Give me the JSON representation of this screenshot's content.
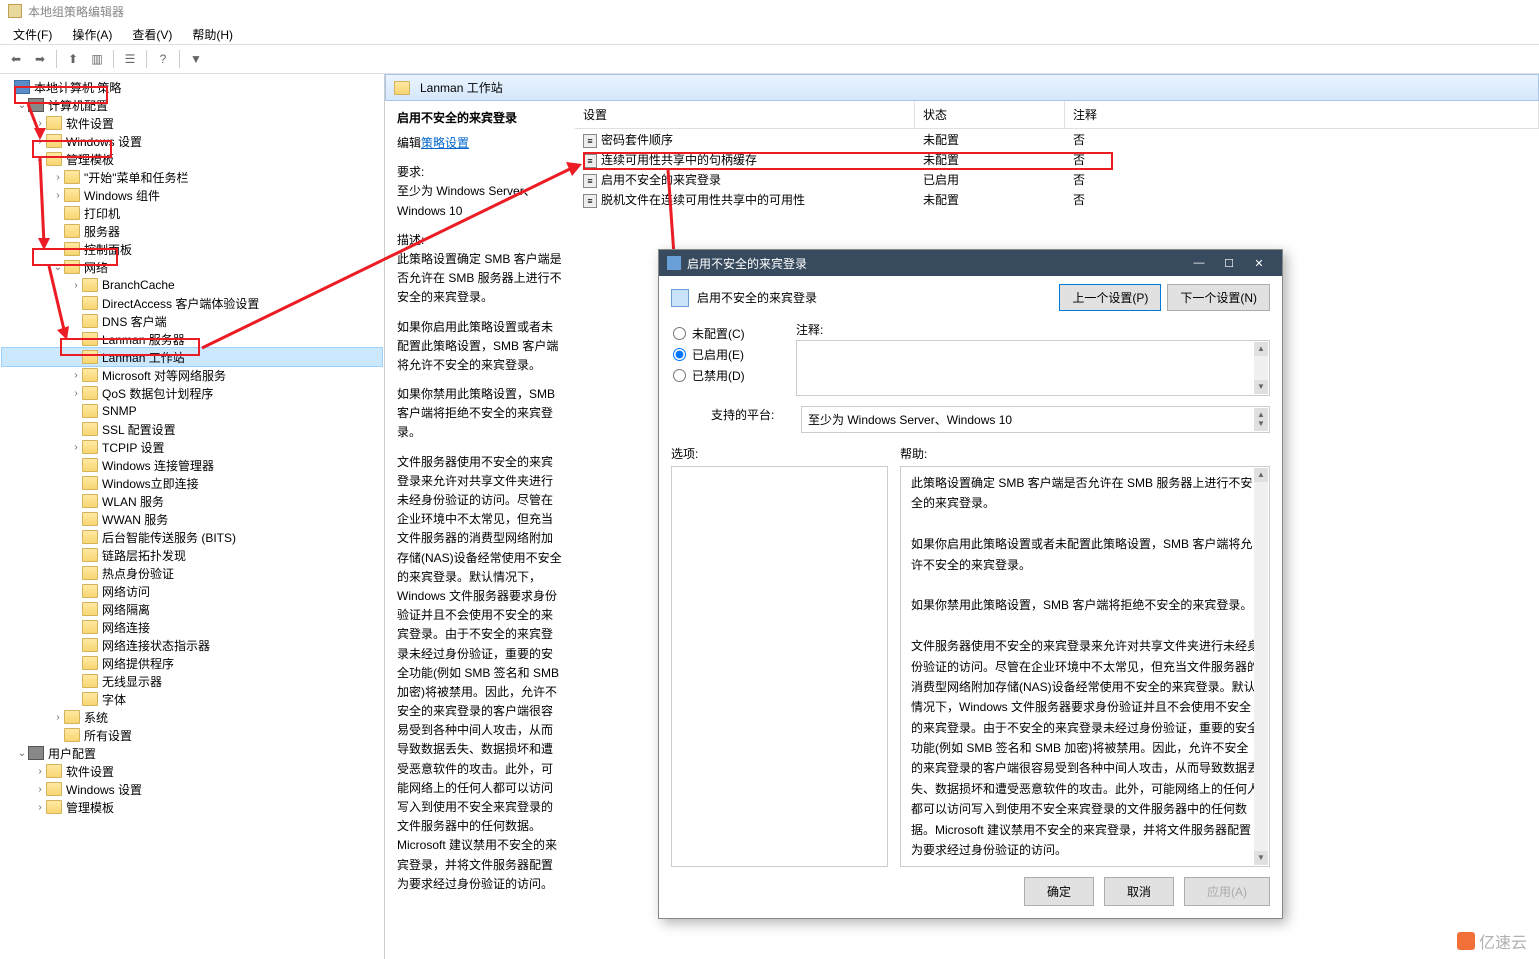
{
  "window": {
    "title": "本地组策略编辑器"
  },
  "menu": {
    "file": "文件(F)",
    "action": "操作(A)",
    "view": "查看(V)",
    "help": "帮助(H)"
  },
  "tree": {
    "root": "本地计算机 策略",
    "computer": "计算机配置",
    "software": "软件设置",
    "windows": "Windows 设置",
    "templates": "管理模板",
    "start_taskbar": "\"开始\"菜单和任务栏",
    "win_components": "Windows 组件",
    "printers": "打印机",
    "server": "服务器",
    "control_panel": "控制面板",
    "network": "网络",
    "branchcache": "BranchCache",
    "directaccess": "DirectAccess 客户端体验设置",
    "dns": "DNS 客户端",
    "lanman_server": "Lanman 服务器",
    "lanman_workstation": "Lanman 工作站",
    "ms_peer": "Microsoft 对等网络服务",
    "qos": "QoS 数据包计划程序",
    "snmp": "SNMP",
    "ssl": "SSL 配置设置",
    "tcpip": "TCPIP 设置",
    "win_conn_mgr": "Windows 连接管理器",
    "win_dialup": "Windows立即连接",
    "wlan": "WLAN 服务",
    "wwan": "WWAN 服务",
    "bits": "后台智能传送服务 (BITS)",
    "lltd": "链路层拓扑发现",
    "hotspot": "热点身份验证",
    "net_conn": "网络访问",
    "net_isolation": "网络隔离",
    "net_connections": "网络连接",
    "net_conn_status": "网络连接状态指示器",
    "net_provider": "网络提供程序",
    "wireless_disp": "无线显示器",
    "fonts": "字体",
    "system": "系统",
    "all_settings": "所有设置",
    "user": "用户配置",
    "u_software": "软件设置",
    "u_windows": "Windows 设置",
    "u_templates": "管理模板"
  },
  "content": {
    "path": "Lanman 工作站",
    "setting_title": "启用不安全的来宾登录",
    "edit_label": "编辑",
    "edit_link": "策略设置",
    "req_label": "要求:",
    "req_value": "至少为 Windows Server、Windows 10",
    "desc_label": "描述:",
    "desc_p1": "此策略设置确定 SMB 客户端是否允许在 SMB 服务器上进行不安全的来宾登录。",
    "desc_p2": "如果你启用此策略设置或者未配置此策略设置，SMB 客户端将允许不安全的来宾登录。",
    "desc_p3": "如果你禁用此策略设置，SMB 客户端将拒绝不安全的来宾登录。",
    "desc_p4": "文件服务器使用不安全的来宾登录来允许对共享文件夹进行未经身份验证的访问。尽管在企业环境中不太常见，但充当文件服务器的消费型网络附加存储(NAS)设备经常使用不安全的来宾登录。默认情况下，Windows 文件服务器要求身份验证并且不会使用不安全的来宾登录。由于不安全的来宾登录未经过身份验证，重要的安全功能(例如 SMB 签名和 SMB 加密)将被禁用。因此，允许不安全的来宾登录的客户端很容易受到各种中间人攻击，从而导致数据丢失、数据损坏和遭受恶意软件的攻击。此外，可能网络上的任何人都可以访问写入到使用不安全来宾登录的文件服务器中的任何数据。Microsoft 建议禁用不安全的来宾登录，并将文件服务器配置为要求经过身份验证的访问。"
  },
  "cols": {
    "setting": "设置",
    "status": "状态",
    "comment": "注释"
  },
  "list": {
    "r1_name": "密码套件顺序",
    "r1_status": "未配置",
    "r1_comment": "否",
    "r2_name": "连续可用性共享中的句柄缓存",
    "r2_status": "未配置",
    "r2_comment": "否",
    "r3_name": "启用不安全的来宾登录",
    "r3_status": "已启用",
    "r3_comment": "否",
    "r4_name": "脱机文件在连续可用性共享中的可用性",
    "r4_status": "未配置",
    "r4_comment": "否"
  },
  "dialog": {
    "title": "启用不安全的来宾登录",
    "heading": "启用不安全的来宾登录",
    "prev": "上一个设置(P)",
    "next": "下一个设置(N)",
    "not_configured": "未配置(C)",
    "enabled": "已启用(E)",
    "disabled": "已禁用(D)",
    "comment_label": "注释:",
    "platform_label": "支持的平台:",
    "platform_value": "至少为 Windows Server、Windows 10",
    "options_label": "选项:",
    "help_label": "帮助:",
    "help_p1": "此策略设置确定 SMB 客户端是否允许在 SMB 服务器上进行不安全的来宾登录。",
    "help_p2": "如果你启用此策略设置或者未配置此策略设置，SMB 客户端将允许不安全的来宾登录。",
    "help_p3": "如果你禁用此策略设置，SMB 客户端将拒绝不安全的来宾登录。",
    "help_p4": "文件服务器使用不安全的来宾登录来允许对共享文件夹进行未经身份验证的访问。尽管在企业环境中不太常见，但充当文件服务器的消费型网络附加存储(NAS)设备经常使用不安全的来宾登录。默认情况下，Windows 文件服务器要求身份验证并且不会使用不安全的来宾登录。由于不安全的来宾登录未经过身份验证，重要的安全功能(例如 SMB 签名和 SMB 加密)将被禁用。因此，允许不安全的来宾登录的客户端很容易受到各种中间人攻击，从而导致数据丢失、数据损坏和遭受恶意软件的攻击。此外，可能网络上的任何人都可以访问写入到使用不安全来宾登录的文件服务器中的任何数据。Microsoft 建议禁用不安全的来宾登录，并将文件服务器配置为要求经过身份验证的访问。",
    "ok": "确定",
    "cancel": "取消",
    "apply": "应用(A)"
  },
  "watermark": "亿速云"
}
